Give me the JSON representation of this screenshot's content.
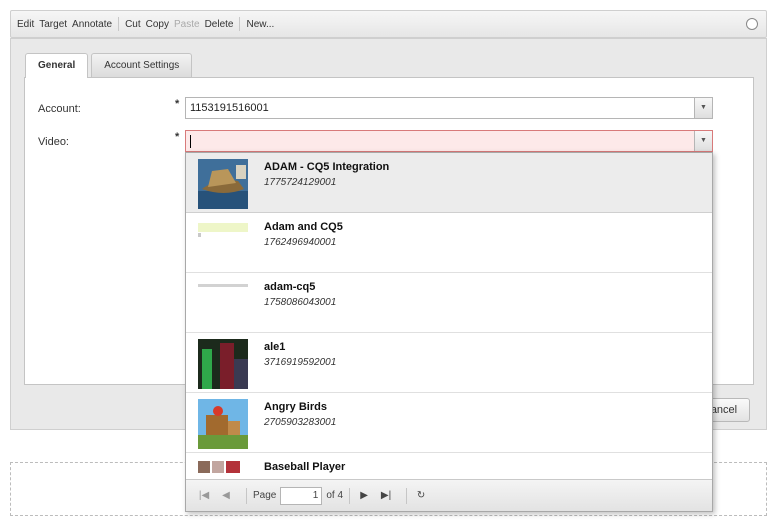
{
  "toolbar": {
    "items": [
      "Edit",
      "Target",
      "Annotate",
      "Cut",
      "Copy",
      "Paste",
      "Delete",
      "New..."
    ]
  },
  "tabs": [
    "General",
    "Account Settings"
  ],
  "form": {
    "account_label": "Account:",
    "account_value": "1153191516001",
    "video_label": "Video:",
    "required_mark": "*"
  },
  "dropdown": {
    "items": [
      {
        "name": "ADAM - CQ5 Integration",
        "id": "1775724129001"
      },
      {
        "name": "Adam and CQ5",
        "id": "1762496940001"
      },
      {
        "name": "adam-cq5",
        "id": "1758086043001"
      },
      {
        "name": "ale1",
        "id": "3716919592001"
      },
      {
        "name": "Angry Birds",
        "id": "2705903283001"
      },
      {
        "name": "Baseball Player",
        "id": ""
      }
    ],
    "pager": {
      "page_label": "Page",
      "page_value": "1",
      "of_label": "of 4"
    }
  },
  "buttons": {
    "cancel": "Cancel"
  }
}
